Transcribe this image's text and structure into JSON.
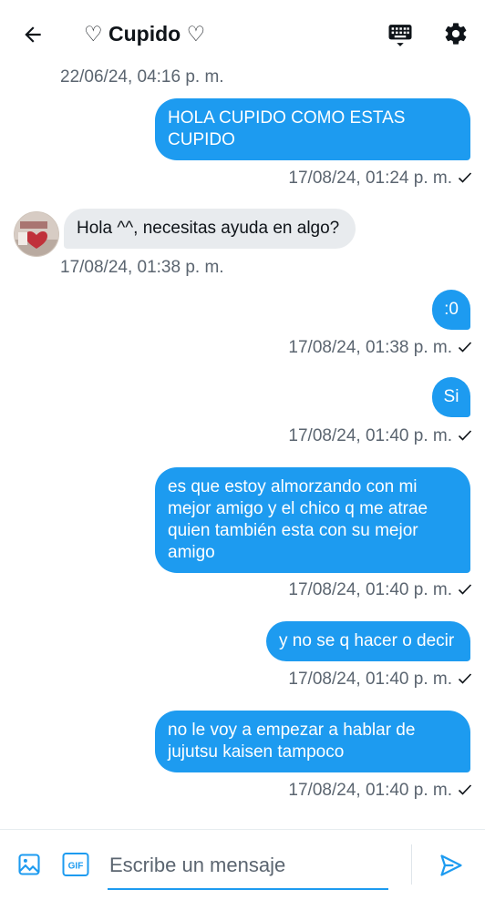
{
  "header": {
    "title": "♡ Cupido ♡",
    "back_icon": "arrow-left-icon",
    "keyboard_icon": "keyboard-icon",
    "settings_icon": "gear-icon"
  },
  "messages": [
    {
      "direction": "in",
      "text": "",
      "timestamp": "22/06/24, 04:16 p. m."
    },
    {
      "direction": "out",
      "text": "HOLA CUPIDO COMO ESTAS CUPIDO",
      "timestamp": "17/08/24, 01:24 p. m."
    },
    {
      "direction": "in",
      "text": "Hola ^^, necesitas ayuda en algo?",
      "timestamp": "17/08/24, 01:38 p. m."
    },
    {
      "direction": "out",
      "text": ":0",
      "timestamp": "17/08/24, 01:38 p. m."
    },
    {
      "direction": "out",
      "text": "Si",
      "timestamp": "17/08/24, 01:40 p. m."
    },
    {
      "direction": "out",
      "text": "es que estoy almorzando con mi mejor amigo y el chico q me atrae quien también esta con su mejor amigo",
      "timestamp": "17/08/24, 01:40 p. m."
    },
    {
      "direction": "out",
      "text": "y no se q hacer o decir",
      "timestamp": "17/08/24, 01:40 p. m."
    },
    {
      "direction": "out",
      "text": "no le voy a empezar a hablar de jujutsu kaisen tampoco",
      "timestamp": "17/08/24, 01:40 p. m."
    }
  ],
  "composer": {
    "placeholder": "Escribe un mensaje",
    "image_icon": "image-icon",
    "gif_label": "GIF",
    "send_icon": "send-icon"
  },
  "colors": {
    "accent": "#1d9bf0",
    "incoming_bubble": "#e8ebee",
    "timestamp_text": "#5b6570"
  }
}
